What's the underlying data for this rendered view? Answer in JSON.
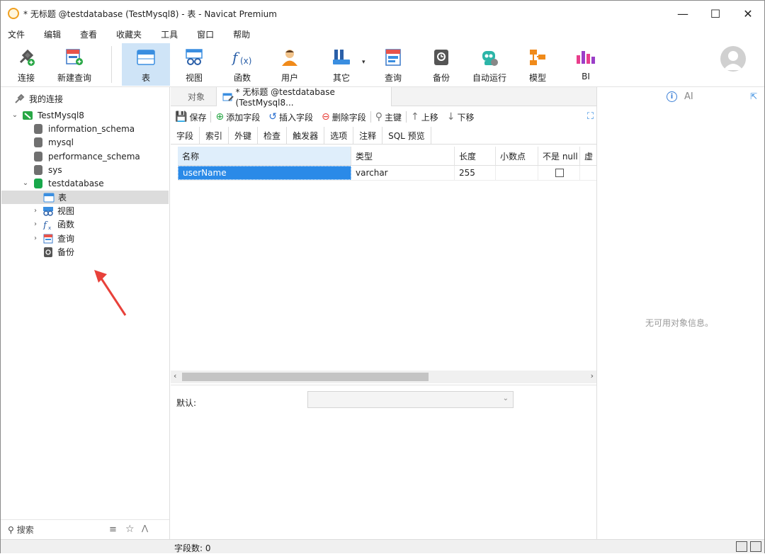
{
  "window": {
    "title": "* 无标题 @testdatabase (TestMysql8) - 表 - Navicat Premium",
    "controls": [
      "minimize",
      "maximize",
      "close"
    ]
  },
  "menu": [
    "文件",
    "编辑",
    "查看",
    "收藏夹",
    "工具",
    "窗口",
    "帮助"
  ],
  "toolbar": {
    "items": [
      {
        "label": "连接",
        "icon": "connection-icon"
      },
      {
        "label": "新建查询",
        "icon": "new-query-icon"
      },
      {
        "label": "表",
        "icon": "table-icon",
        "active": true
      },
      {
        "label": "视图",
        "icon": "view-icon"
      },
      {
        "label": "函数",
        "icon": "function-icon"
      },
      {
        "label": "用户",
        "icon": "user-icon"
      },
      {
        "label": "其它",
        "icon": "tools-icon"
      },
      {
        "label": "查询",
        "icon": "query-icon"
      },
      {
        "label": "备份",
        "icon": "backup-icon"
      },
      {
        "label": "自动运行",
        "icon": "robot-icon"
      },
      {
        "label": "模型",
        "icon": "model-icon"
      },
      {
        "label": "BI",
        "icon": "bi-icon"
      }
    ]
  },
  "sidebar": {
    "header": "我的连接",
    "connection": "TestMysql8",
    "databases": [
      "information_schema",
      "mysql",
      "performance_schema",
      "sys"
    ],
    "active_db": "testdatabase",
    "objects": [
      "表",
      "视图",
      "函数",
      "查询",
      "备份"
    ],
    "search_placeholder": "搜索"
  },
  "editor": {
    "object_tab": "对象",
    "current_tab": "* 无标题 @testdatabase (TestMysql8...",
    "actions": {
      "save": "保存",
      "add_field": "添加字段",
      "insert_field": "插入字段",
      "delete_field": "删除字段",
      "primary_key": "主键",
      "move_up": "上移",
      "move_down": "下移"
    },
    "subtabs": [
      "字段",
      "索引",
      "外键",
      "检查",
      "触发器",
      "选项",
      "注释",
      "SQL 预览"
    ],
    "columns": [
      "名称",
      "类型",
      "长度",
      "小数点",
      "不是 null",
      "虚"
    ],
    "rows": [
      {
        "name": "userName",
        "type": "varchar",
        "length": "255",
        "decimal": "",
        "not_null": false
      }
    ],
    "default_label": "默认:"
  },
  "info_panel": {
    "ai_label": "AI",
    "empty_text": "无可用对象信息。"
  },
  "status": {
    "field_count": "字段数: 0"
  },
  "colors": {
    "selection": "#2a8ae8",
    "active_tool": "#cfe4f7",
    "db_green": "#18a84b",
    "arrow": "#e8413a"
  }
}
